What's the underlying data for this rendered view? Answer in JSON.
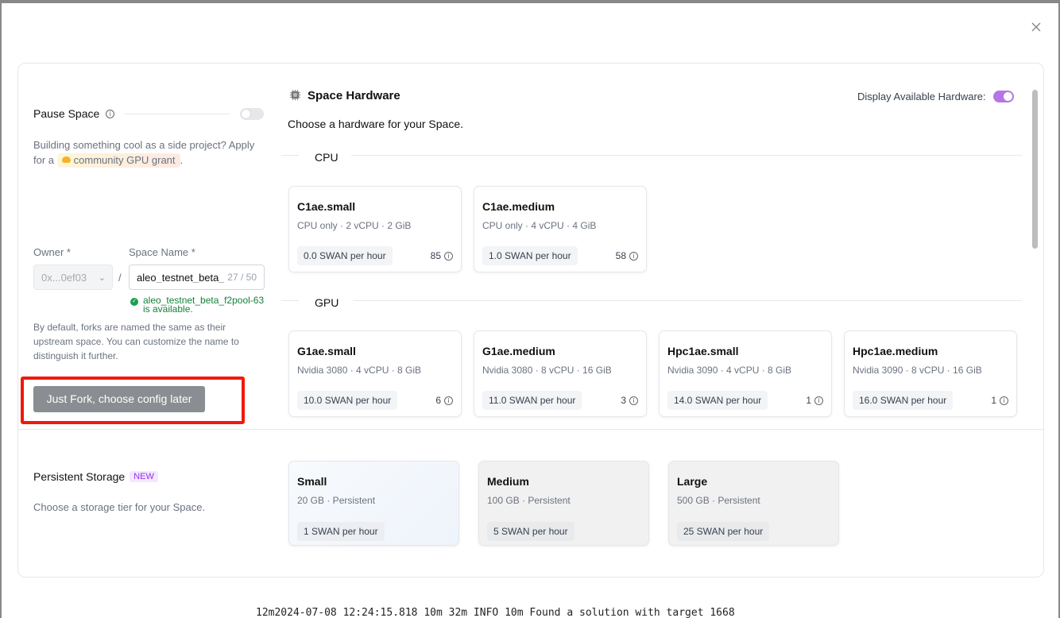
{
  "background_log": "12m2024-07-08 12:24:15.818 10m  32m INFO 10m Found a solution with target 1668",
  "pause": {
    "label": "Pause Space"
  },
  "grant": {
    "text_before": "Building something cool as a side project? Apply for a",
    "pill": "community GPU grant",
    "text_after": "."
  },
  "owner": {
    "label": "Owner *",
    "value": "0x...0ef03"
  },
  "space_name": {
    "label": "Space Name *",
    "value": "aleo_testnet_beta_",
    "count": "27 / 50",
    "available_line1": "aleo_testnet_beta_f2pool-63",
    "available_line2": "is available."
  },
  "separator": "/",
  "fork_desc": "By default, forks are named the same as their upstream space. You can customize the name to distinguish it further.",
  "fork_button": "Just Fork, choose config later",
  "hardware": {
    "title": "Space Hardware",
    "subtitle": "Choose a hardware for your Space.",
    "display_available_label": "Display Available Hardware:",
    "display_available_on": true,
    "cpu_label": "CPU",
    "gpu_label": "GPU",
    "cpu": [
      {
        "name": "C1ae.small",
        "spec": "CPU only · 2 vCPU · 2 GiB",
        "price": "0.0 SWAN per hour",
        "count": "85"
      },
      {
        "name": "C1ae.medium",
        "spec": "CPU only · 4 vCPU · 4 GiB",
        "price": "1.0 SWAN per hour",
        "count": "58"
      }
    ],
    "gpu": [
      {
        "name": "G1ae.small",
        "spec": "Nvidia 3080 · 4 vCPU · 8 GiB",
        "price": "10.0 SWAN per hour",
        "count": "6"
      },
      {
        "name": "G1ae.medium",
        "spec": "Nvidia 3080 · 8 vCPU · 16 GiB",
        "price": "11.0 SWAN per hour",
        "count": "3"
      },
      {
        "name": "Hpc1ae.small",
        "spec": "Nvidia 3090 · 4 vCPU · 8 GiB",
        "price": "14.0 SWAN per hour",
        "count": "1"
      },
      {
        "name": "Hpc1ae.medium",
        "spec": "Nvidia 3090 · 8 vCPU · 16 GiB",
        "price": "16.0 SWAN per hour",
        "count": "1"
      }
    ]
  },
  "storage": {
    "title": "Persistent Storage",
    "badge": "NEW",
    "subtitle": "Choose a storage tier for your Space.",
    "tiers": [
      {
        "name": "Small",
        "spec": "20 GB  ·  Persistent",
        "price": "1 SWAN per hour"
      },
      {
        "name": "Medium",
        "spec": "100 GB  ·  Persistent",
        "price": "5 SWAN per hour"
      },
      {
        "name": "Large",
        "spec": "500 GB  ·  Persistent",
        "price": "25 SWAN per hour"
      }
    ]
  },
  "colors": {
    "accent": "#b675e6",
    "highlight": "#f2180c",
    "success": "#15803d"
  }
}
